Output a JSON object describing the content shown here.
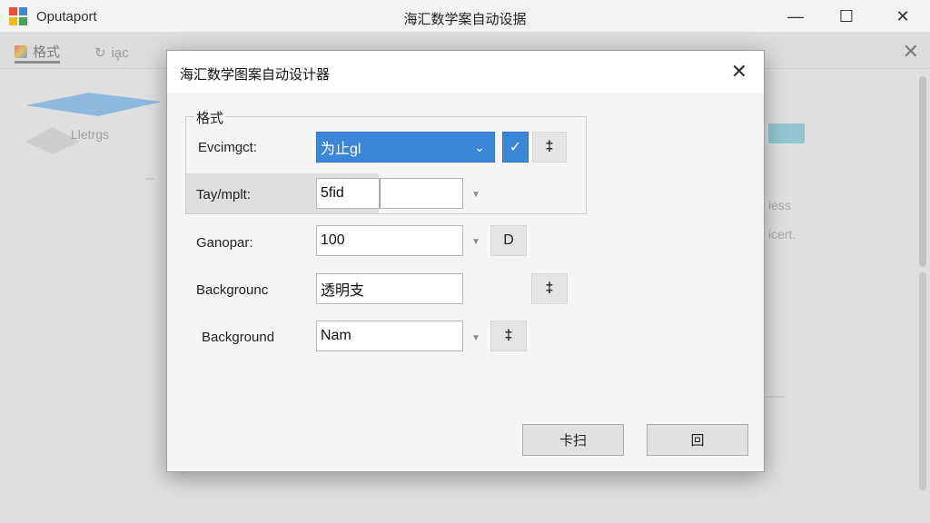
{
  "app": {
    "name": "Oputaport",
    "window_title": "海汇数学案自动设据",
    "window_controls": {
      "minimize": "—",
      "maximize": "☐",
      "close": "✕"
    }
  },
  "toolbar": {
    "tabs": [
      {
        "icon": "palette-icon",
        "label": "格式"
      },
      {
        "icon": "refresh-icon",
        "label": "ia̧c"
      },
      {
        "icon": "",
        "label": ""
      }
    ],
    "close": "✕"
  },
  "background": {
    "thumb_label": "Lletrgs",
    "right_texts": [
      "iess",
      "icert."
    ]
  },
  "dialog": {
    "title": "海汇数学图案自动设计器",
    "close": "✕",
    "group_legend": "格式",
    "rows": [
      {
        "label": "Evcimgct:",
        "value": "为止gl",
        "dropdown": "⌄",
        "check": "✓",
        "extra": "‡"
      },
      {
        "label": "Tay/mplt:",
        "value": "5fid",
        "dropdown": "▼"
      },
      {
        "label": "Ganopar:",
        "value": "100",
        "dropdown": "▼",
        "extra": "D"
      },
      {
        "label": "Backgrounc",
        "value": "透明支",
        "extra": "‡"
      },
      {
        "label": "Background",
        "value": "Nam",
        "dropdown": "▼",
        "extra": "‡"
      }
    ],
    "buttons": {
      "ok": "卡扫",
      "cancel": "回"
    }
  },
  "colors": {
    "accent": "#3c86d8",
    "teal": "#4fb7c9"
  }
}
